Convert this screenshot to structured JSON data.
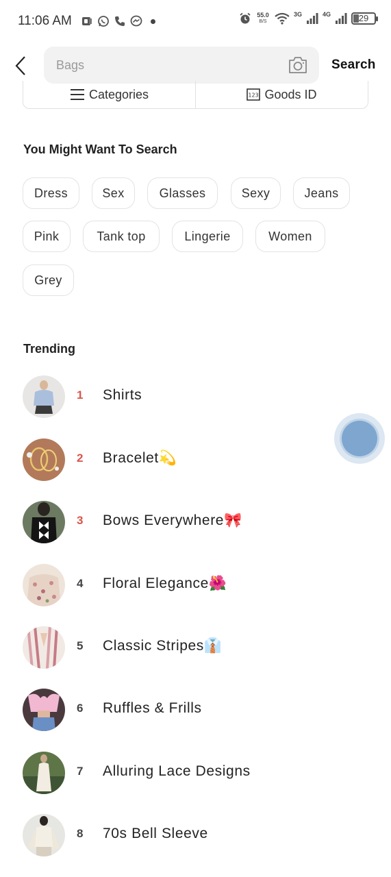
{
  "status_bar": {
    "time": "11:06 AM",
    "net_speed": "55.0",
    "net_speed_unit": "B/S",
    "net_3g": "3G",
    "net_4g": "4G",
    "battery": "29"
  },
  "search": {
    "placeholder": "Bags",
    "button_label": "Search"
  },
  "filters": {
    "categories_label": "Categories",
    "goods_id_label": "Goods ID"
  },
  "suggest": {
    "title": "You Might Want To Search",
    "chips": [
      "Dress",
      "Sex",
      "Glasses",
      "Sexy",
      "Jeans",
      "Pink",
      "Tank top",
      "Lingerie",
      "Women",
      "Grey"
    ]
  },
  "trending": {
    "title": "Trending",
    "items": [
      {
        "rank": "1",
        "label": "Shirts",
        "color": "#d9564b"
      },
      {
        "rank": "2",
        "label": "Bracelet💫",
        "color": "#d9564b"
      },
      {
        "rank": "3",
        "label": "Bows Everywhere🎀",
        "color": "#d9564b"
      },
      {
        "rank": "4",
        "label": "Floral Elegance🌺",
        "color": "#444444"
      },
      {
        "rank": "5",
        "label": "Classic Stripes👔",
        "color": "#444444"
      },
      {
        "rank": "6",
        "label": "Ruffles & Frills",
        "color": "#444444"
      },
      {
        "rank": "7",
        "label": "Alluring Lace Designs",
        "color": "#444444"
      },
      {
        "rank": "8",
        "label": "70s Bell Sleeve",
        "color": "#444444"
      }
    ]
  },
  "colors": {
    "accent_rank": "#d9564b",
    "bubble": "#7fa6cf"
  }
}
